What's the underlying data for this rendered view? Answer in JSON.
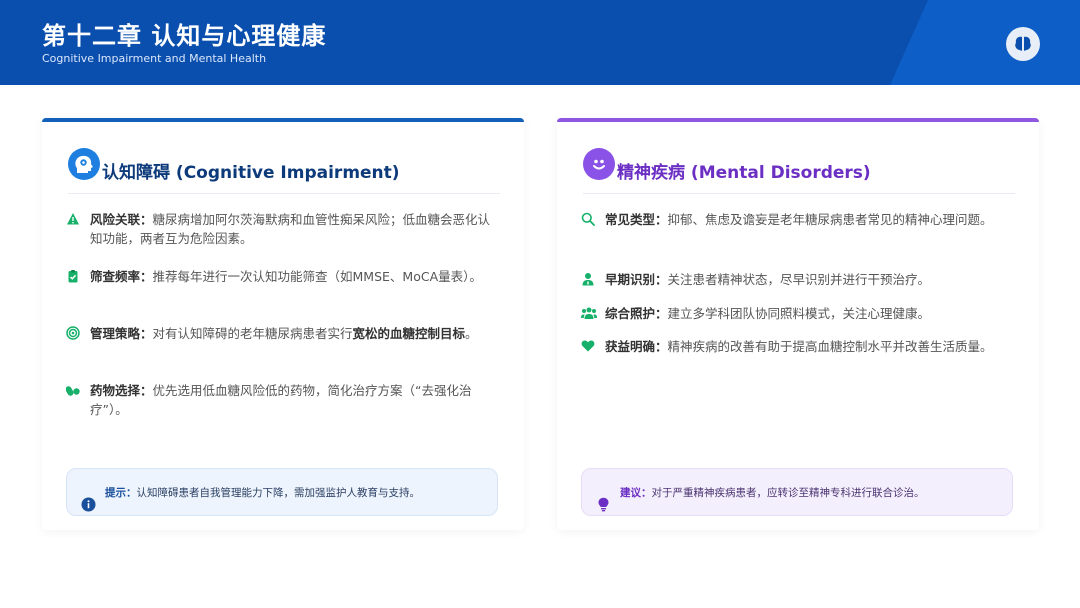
{
  "header": {
    "title": "第十二章 认知与心理健康",
    "subtitle": "Cognitive Impairment and Mental Health",
    "icon": "brain-icon"
  },
  "colors": {
    "header_bg": "#0a4fae",
    "left_accent": "#1260b8",
    "right_accent": "#8f57e0",
    "icon_green": "#16b06a"
  },
  "cognitive": {
    "title": "认知障碍 (Cognitive Impairment)",
    "icon": "head-gear-icon",
    "items": [
      {
        "icon": "warning-icon",
        "label": "风险关联：",
        "text": "糖尿病增加阿尔茨海默病和血管性痴呆风险；低血糖会恶化认知功能，两者互为危险因素。"
      },
      {
        "icon": "clipboard-check-icon",
        "label": "筛查频率：",
        "text": "推荐每年进行一次认知功能筛查（如MMSE、MoCA量表）。"
      },
      {
        "icon": "target-icon",
        "label": "管理策略：",
        "text_pre": "对有认知障碍的老年糖尿病患者实行",
        "text_bold": "宽松的血糖控制目标",
        "text_post": "。"
      },
      {
        "icon": "pills-icon",
        "label": "药物选择：",
        "text": "优先选用低血糖风险低的药物，简化治疗方案（“去强化治疗”）。"
      }
    ],
    "note": {
      "icon": "info-icon",
      "label": "提示：",
      "text": "认知障碍患者自我管理能力下降，需加强监护人教育与支持。"
    }
  },
  "mental": {
    "title": "精神疾病 (Mental Disorders)",
    "icon": "smile-icon",
    "items": [
      {
        "icon": "search-icon",
        "label": "常见类型：",
        "text": "抑郁、焦虑及谵妄是老年糖尿病患者常见的精神心理问题。"
      },
      {
        "icon": "user-doctor-icon",
        "label": "早期识别：",
        "text": "关注患者精神状态，尽早识别并进行干预治疗。"
      },
      {
        "icon": "users-icon",
        "label": "综合照护：",
        "text": "建立多学科团队协同照料模式，关注心理健康。"
      },
      {
        "icon": "heart-icon",
        "label": "获益明确：",
        "text": "精神疾病的改善有助于提高血糖控制水平并改善生活质量。"
      }
    ],
    "note": {
      "icon": "lightbulb-icon",
      "label": "建议：",
      "text": "对于严重精神疾病患者，应转诊至精神专科进行联合诊治。"
    }
  }
}
